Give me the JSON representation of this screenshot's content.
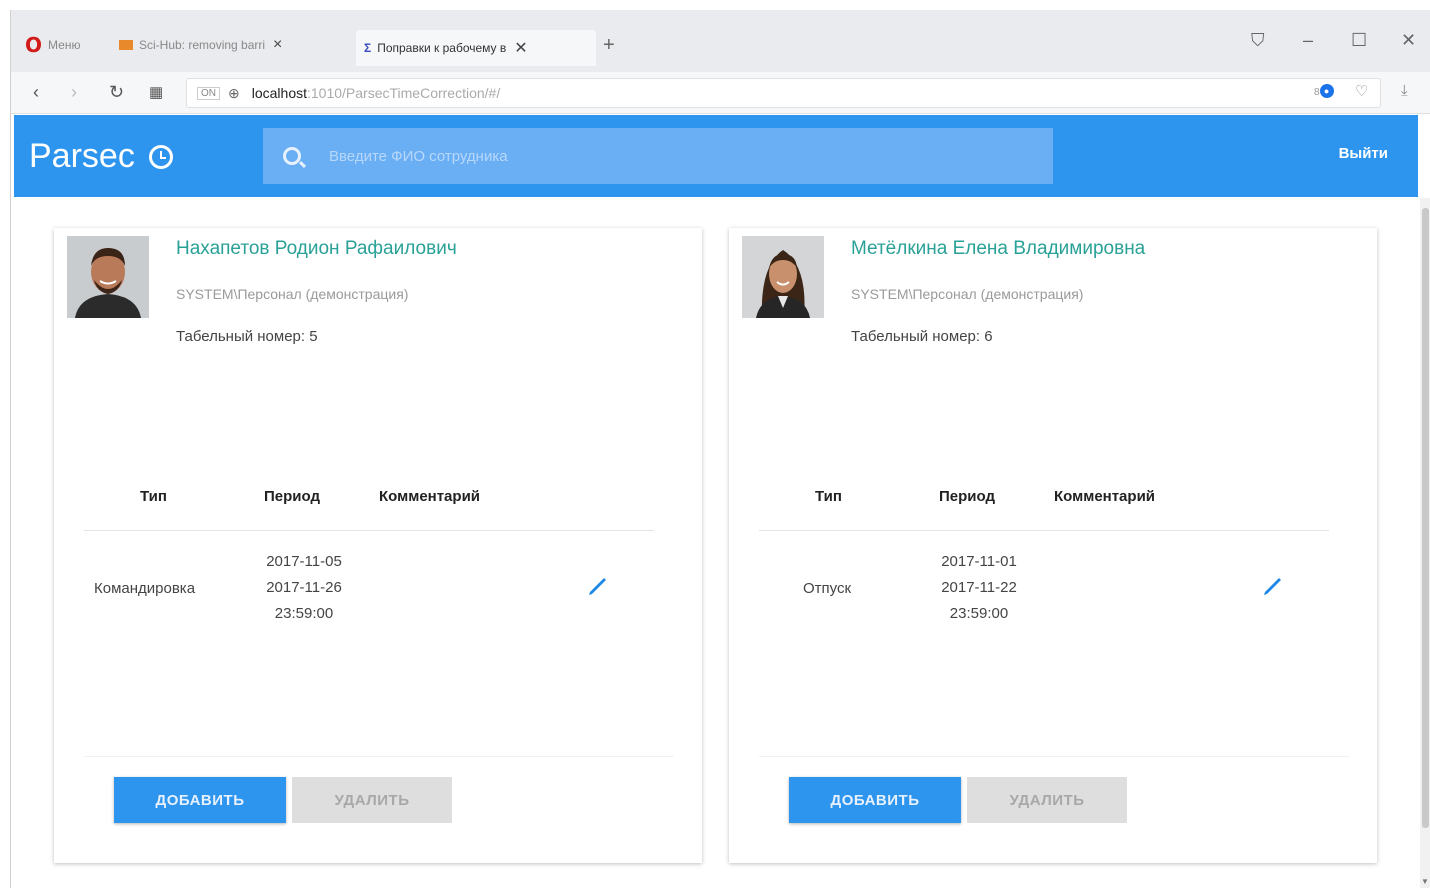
{
  "browser": {
    "tabs": [
      {
        "label": "Меню"
      },
      {
        "label": "Sci-Hub: removing barri"
      },
      {
        "label": "Поправки к рабочему в"
      }
    ],
    "url_host": "localhost",
    "url_path": ":1010/ParsecTimeCorrection/#/",
    "url_badge": "ON",
    "badge_count": "8"
  },
  "app": {
    "brand": "Parsec",
    "search_placeholder": "Введите ФИО сотрудника",
    "logout_label": "Выйти"
  },
  "table_headers": {
    "type": "Тип",
    "period": "Период",
    "comment": "Комментарий"
  },
  "buttons": {
    "add": "ДОБАВИТЬ",
    "delete": "УДАЛИТЬ"
  },
  "employees": [
    {
      "name": "Нахапетов Родион Рафаилович",
      "department": "SYSTEM\\Персонал (демонстрация)",
      "tab_number": "Табельный номер: 5",
      "rows": [
        {
          "type": "Командировка",
          "period_start": "2017-11-05",
          "period_end": "2017-11-26",
          "period_time": "23:59:00",
          "comment": ""
        }
      ]
    },
    {
      "name": "Метёлкина Елена Владимировна",
      "department": "SYSTEM\\Персонал (демонстрация)",
      "tab_number": "Табельный номер: 6",
      "rows": [
        {
          "type": "Отпуск",
          "period_start": "2017-11-01",
          "period_end": "2017-11-22",
          "period_time": "23:59:00",
          "comment": ""
        }
      ]
    }
  ],
  "colors": {
    "accent": "#2e95ef",
    "name": "#2aa197",
    "edit": "#1e88e5"
  }
}
